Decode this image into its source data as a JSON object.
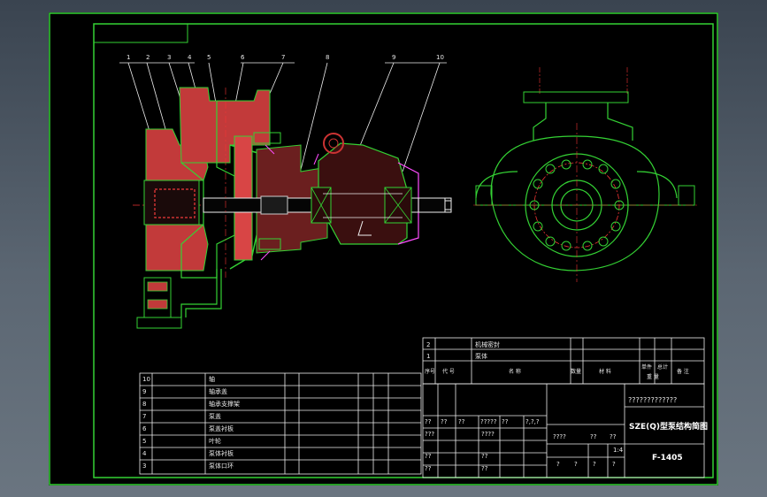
{
  "callouts": [
    "1",
    "2",
    "3",
    "4",
    "5",
    "6",
    "7",
    "8",
    "9",
    "10"
  ],
  "parts_list": [
    {
      "no": "10",
      "name": "轴"
    },
    {
      "no": "9",
      "name": "轴承盖"
    },
    {
      "no": "8",
      "name": "轴承支撑架"
    },
    {
      "no": "7",
      "name": "泵盖"
    },
    {
      "no": "6",
      "name": "泵盖衬板"
    },
    {
      "no": "5",
      "name": "叶轮"
    },
    {
      "no": "4",
      "name": "泵体衬板"
    },
    {
      "no": "3",
      "name": "泵体口环"
    }
  ],
  "upper_list": [
    {
      "no": "2",
      "name": "机械密封"
    },
    {
      "no": "1",
      "name": "泵体"
    }
  ],
  "header_row": {
    "seq": "序号",
    "code": "代 号",
    "name": "名 称",
    "qty": "数量",
    "material": "材 料",
    "unit_weight": "单件",
    "total_weight": "总计",
    "weight": "重 量",
    "remark": "备 注"
  },
  "title_block": {
    "company": "?????????????",
    "drawing_title": "SZE(Q)型泵结构简图",
    "drawing_number": "F-1405",
    "scale": "1:4",
    "row1": [
      "??",
      "??",
      "??",
      "?????",
      "??",
      "?,?,?"
    ],
    "row2": [
      "???",
      "????"
    ],
    "row3": [
      "????",
      "??",
      "??"
    ],
    "row4": [
      "??",
      "??"
    ],
    "row5": [
      "??",
      "??"
    ],
    "sheet_marks": [
      "?",
      "?",
      "?",
      "?"
    ]
  }
}
